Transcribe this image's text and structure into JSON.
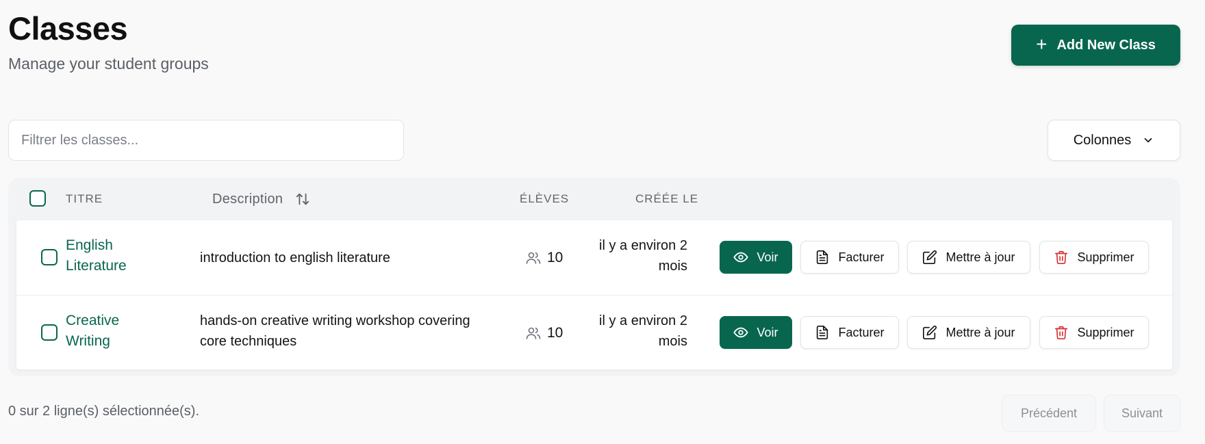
{
  "header": {
    "title": "Classes",
    "subtitle": "Manage your student groups",
    "add_button_label": "Add New Class"
  },
  "toolbar": {
    "filter_placeholder": "Filtrer les classes...",
    "columns_label": "Colonnes"
  },
  "table": {
    "columns": {
      "title": "TITRE",
      "description": "Description",
      "students": "ÉLÈVES",
      "created": "CRÉÉE LE"
    },
    "rows": [
      {
        "title_line1": "English",
        "title_line2": "Literature",
        "description_line1": "introduction to english literature",
        "description_line2": "",
        "students": "10",
        "created_line1": "il y a environ 2",
        "created_line2": "mois"
      },
      {
        "title_line1": "Creative",
        "title_line2": "Writing",
        "description_line1": "hands-on creative writing workshop covering",
        "description_line2": "core techniques",
        "students": "10",
        "created_line1": "il y a environ 2",
        "created_line2": "mois"
      }
    ],
    "actions": {
      "view": "Voir",
      "invoice": "Facturer",
      "update": "Mettre à jour",
      "delete": "Supprimer"
    }
  },
  "footer": {
    "selection_status": "0 sur 2 ligne(s) sélectionnée(s).",
    "previous_label": "Précédent",
    "next_label": "Suivant"
  },
  "colors": {
    "primary": "#08664f",
    "danger": "#d92d2d",
    "muted_text": "#5a5f66"
  },
  "icons": {
    "add": "plus-icon",
    "columns": "chevron-down-icon",
    "sort": "sort-arrows-icon",
    "students": "users-icon",
    "view": "eye-icon",
    "invoice": "document-icon",
    "update": "edit-icon",
    "delete": "trash-icon"
  }
}
